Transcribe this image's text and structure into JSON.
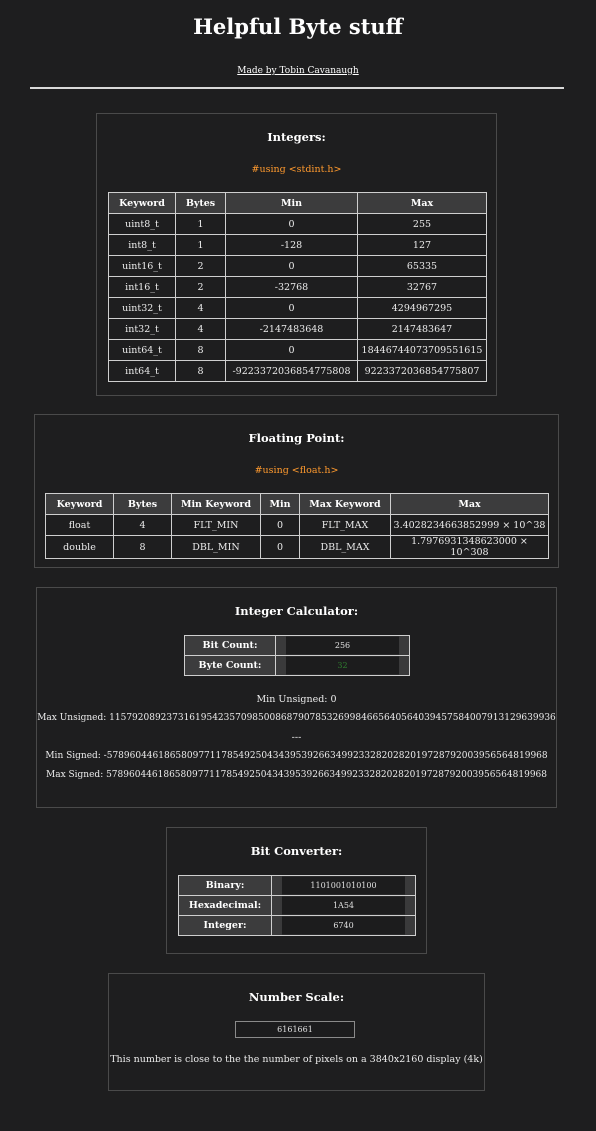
{
  "header": {
    "title": "Helpful Byte stuff",
    "credit": "Made by Tobin Cavanaugh"
  },
  "integers": {
    "title": "Integers:",
    "include": "#using <stdint.h>",
    "columns": [
      "Keyword",
      "Bytes",
      "Min",
      "Max"
    ],
    "rows": [
      [
        "uint8_t",
        "1",
        "0",
        "255"
      ],
      [
        "int8_t",
        "1",
        "-128",
        "127"
      ],
      [
        "uint16_t",
        "2",
        "0",
        "65335"
      ],
      [
        "int16_t",
        "2",
        "-32768",
        "32767"
      ],
      [
        "uint32_t",
        "4",
        "0",
        "4294967295"
      ],
      [
        "int32_t",
        "4",
        "-2147483648",
        "2147483647"
      ],
      [
        "uint64_t",
        "8",
        "0",
        "18446744073709551615"
      ],
      [
        "int64_t",
        "8",
        "-9223372036854775808",
        "9223372036854775807"
      ]
    ]
  },
  "floating": {
    "title": "Floating Point:",
    "include": "#using <float.h>",
    "columns": [
      "Keyword",
      "Bytes",
      "Min Keyword",
      "Min",
      "Max Keyword",
      "Max"
    ],
    "rows": [
      [
        "float",
        "4",
        "FLT_MIN",
        "0",
        "FLT_MAX",
        "3.4028234663852999 × 10^38"
      ],
      [
        "double",
        "8",
        "DBL_MIN",
        "0",
        "DBL_MAX",
        "1.7976931348623000 × 10^308"
      ]
    ]
  },
  "calculator": {
    "title": "Integer Calculator:",
    "bit_count_label": "Bit Count:",
    "bit_count_value": "256",
    "byte_count_label": "Byte Count:",
    "byte_count_value": "32",
    "min_unsigned": "Min Unsigned: 0",
    "max_unsigned": "Max Unsigned: 115792089237316195423570985008687907853269984665640564039457584007913129639936",
    "separator": "---",
    "min_signed": "Min Signed: -57896044618658097711785492504343953926634992332820282019728792003956564819968",
    "max_signed": "Max Signed: 57896044618658097711785492504343953926634992332820282019728792003956564819968"
  },
  "converter": {
    "title": "Bit Converter:",
    "binary_label": "Binary:",
    "binary_value": "1101001010100",
    "hex_label": "Hexadecimal:",
    "hex_value": "1A54",
    "int_label": "Integer:",
    "int_value": "6740"
  },
  "scale": {
    "title": "Number Scale:",
    "input_value": "6161661",
    "description": "This number is close to the the number of pixels on a 3840x2160 display (4k)"
  },
  "colors": {
    "background": "#1e1e1f",
    "include_accent": "#ff9a2e",
    "byte_count_value": "#2f7d2f"
  }
}
